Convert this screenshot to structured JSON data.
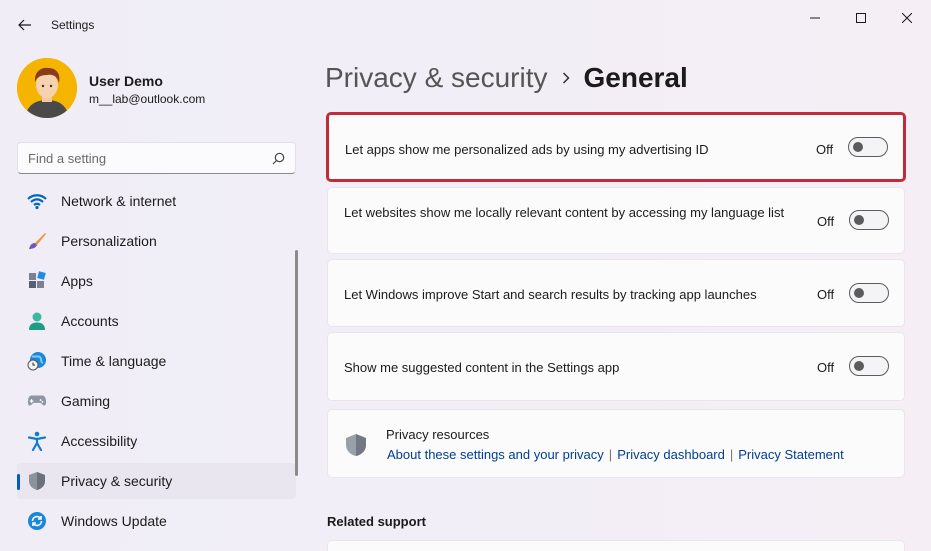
{
  "window": {
    "title": "Settings"
  },
  "user": {
    "name": "User Demo",
    "email": "m__lab@outlook.com"
  },
  "search": {
    "placeholder": "Find a setting"
  },
  "nav": [
    {
      "label": "Network & internet",
      "icon": "wifi-icon"
    },
    {
      "label": "Personalization",
      "icon": "brush-icon"
    },
    {
      "label": "Apps",
      "icon": "apps-icon"
    },
    {
      "label": "Accounts",
      "icon": "person-icon"
    },
    {
      "label": "Time & language",
      "icon": "globe-clock-icon"
    },
    {
      "label": "Gaming",
      "icon": "gamepad-icon"
    },
    {
      "label": "Accessibility",
      "icon": "accessibility-icon"
    },
    {
      "label": "Privacy & security",
      "icon": "shield-icon",
      "active": true
    },
    {
      "label": "Windows Update",
      "icon": "update-icon"
    }
  ],
  "breadcrumb": {
    "parent": "Privacy & security",
    "current": "General"
  },
  "settings": [
    {
      "text": "Let apps show me personalized ads by using my advertising ID",
      "state": "Off"
    },
    {
      "text": "Let websites show me locally relevant content by accessing my language list",
      "state": "Off"
    },
    {
      "text": "Let Windows improve Start and search results by tracking app launches",
      "state": "Off"
    },
    {
      "text": "Show me suggested content in the Settings app",
      "state": "Off"
    }
  ],
  "resources": {
    "title": "Privacy resources",
    "links": [
      "About these settings and your privacy",
      "Privacy dashboard",
      "Privacy Statement"
    ]
  },
  "related_support": {
    "heading": "Related support"
  },
  "colors": {
    "accent": "#005fb8",
    "highlight_border": "#c42b3a",
    "link": "#003e92"
  }
}
